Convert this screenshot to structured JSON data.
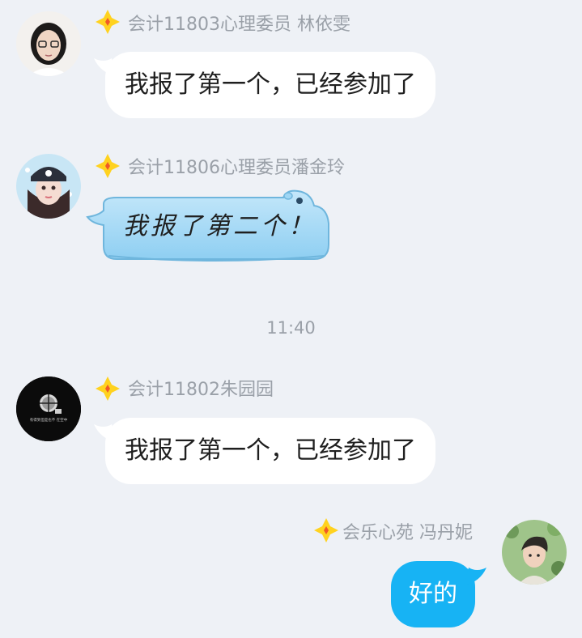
{
  "messages": [
    {
      "sender": "会计11803心理委员  林依雯",
      "text": "我报了第一个，已经参加了",
      "avatar": "girl-glasses-avatar"
    },
    {
      "sender": "会计11806心理委员潘金玲",
      "text": "我报了第二个！",
      "avatar": "girl-cap-avatar",
      "bubble_style": "hippo"
    },
    {
      "sender": "会计11802朱园园",
      "text": "我报了第一个，已经参加了",
      "avatar": "dark-camera-avatar",
      "avatar_text": "有得到但是也不 在空中"
    },
    {
      "sender": "会乐心苑  冯丹妮",
      "text": "好的",
      "avatar": "boy-leaves-avatar",
      "self": true
    }
  ],
  "time_separator": "11:40",
  "colors": {
    "background": "#eef1f6",
    "incoming_bubble": "#ffffff",
    "outgoing_bubble": "#17b3f4",
    "name_text": "#9aa0a8",
    "badge_yellow": "#ffd21f",
    "badge_red": "#f05a28",
    "hippo_bubble": "#a8dcf7"
  },
  "icons": [
    "rank-badge-icon"
  ]
}
